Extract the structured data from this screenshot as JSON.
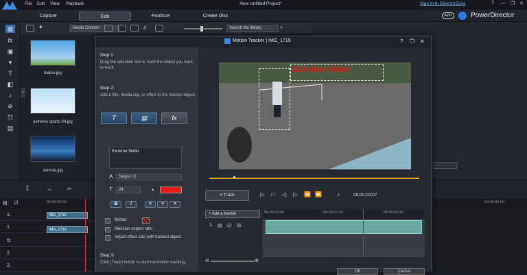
{
  "topbar": {
    "menus": [
      "File",
      "Edit",
      "View",
      "Playback"
    ],
    "project_title": "New Untitled Project*",
    "signin": "Sign in to DirectorZone",
    "window_controls": [
      "?",
      "—",
      "❐",
      "✕"
    ]
  },
  "modebar": {
    "tabs": [
      "Capture",
      "Edit",
      "Produce",
      "Create Disc"
    ],
    "app_badge": "APP",
    "brand": "PowerDirector"
  },
  "library": {
    "media_filter": "Media Content",
    "search_placeholder": "Search the library",
    "items": [
      {
        "label": "ballon.jpg"
      },
      {
        "label": "extreme sports 04.jpg"
      },
      {
        "label": "sunrise.jpg"
      }
    ]
  },
  "timeline": {
    "ruler_times": [
      "00;00;00;00",
      "00;00;35;00"
    ],
    "tracks": [
      "1.",
      "1.",
      "fx",
      "2.",
      "2."
    ],
    "clips": [
      "IMG_1719",
      "IMG_1719"
    ]
  },
  "dialog": {
    "title": "Motion Tracker | IMG_1719",
    "step1_heading": "Step 1:",
    "step1_text": "Drag the selection box to mark the object you want to track.",
    "step2_heading": "Step 2:",
    "step2_text": "Add a title, media clip, or effect to the tracked object.",
    "add_buttons": [
      "T",
      "",
      "fx"
    ],
    "title_text": "Extreme Sk8er",
    "font": "Segoe UI",
    "font_size": "24",
    "bold_label": "B",
    "italic_label": "I",
    "border_label": "Border",
    "maintain_label": "Maintain aspect ratio",
    "adjust_label": "Adjust effect size with tracked object",
    "step3_heading": "Step 3:",
    "step3_text": "Click [Track] button to start the motion tracking.",
    "overlay_text": "Extreme Sk8er",
    "track_button": "Track",
    "timecode": "00;00;03;07",
    "add_tracker": "Add a tracker",
    "ruler_times": [
      "00;00;00;00",
      "00;00;01;20",
      "00;00;03;10"
    ],
    "track_row_label": "1.",
    "bottom_buttons": [
      "OK",
      "Cancel"
    ]
  },
  "colors": {
    "accent": "#2f7de0",
    "title_color": "#e31a1a",
    "seek_color": "#e0a32a",
    "clip_color": "#69a89e"
  }
}
